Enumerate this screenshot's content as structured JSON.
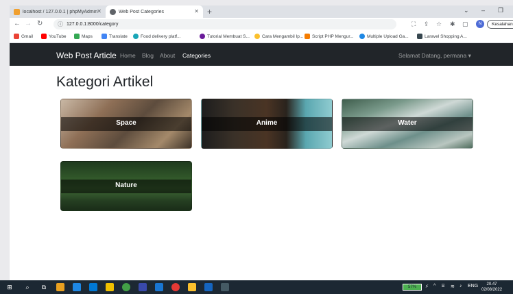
{
  "browser": {
    "tabs": [
      {
        "title": "localhost / 127.0.0.1 | phpMyAdmin",
        "active": false
      },
      {
        "title": "Web Post Categories",
        "active": true
      }
    ],
    "url": "127.0.0.1:8000/category",
    "profile_initial": "N",
    "error_badge": "Kesalahan",
    "bookmarks": [
      "Gmail",
      "YouTube",
      "Maps",
      "Translate",
      "Food delivery platf...",
      "Tutorial Membuat S...",
      "Cara Mengambil Ip...",
      "Script PHP Mengur...",
      "Multiple Upload Ga...",
      "Laravel Shopping A..."
    ]
  },
  "navbar": {
    "brand": "Web Post Article",
    "links": [
      "Home",
      "Blog",
      "About",
      "Categories"
    ],
    "active_link": "Categories",
    "greeting": "Selamat Datang, permana"
  },
  "page": {
    "title": "Kategori Artikel",
    "categories": [
      {
        "name": "Space"
      },
      {
        "name": "Anime"
      },
      {
        "name": "Water"
      },
      {
        "name": "Nature"
      }
    ]
  },
  "taskbar": {
    "battery": "57%",
    "language": "ENG",
    "time": "20.47",
    "date": "02/08/2022"
  },
  "colors": {
    "navbar_bg": "#212529",
    "taskbar_bg": "#1c2833",
    "tab_strip": "#dee1e6"
  }
}
